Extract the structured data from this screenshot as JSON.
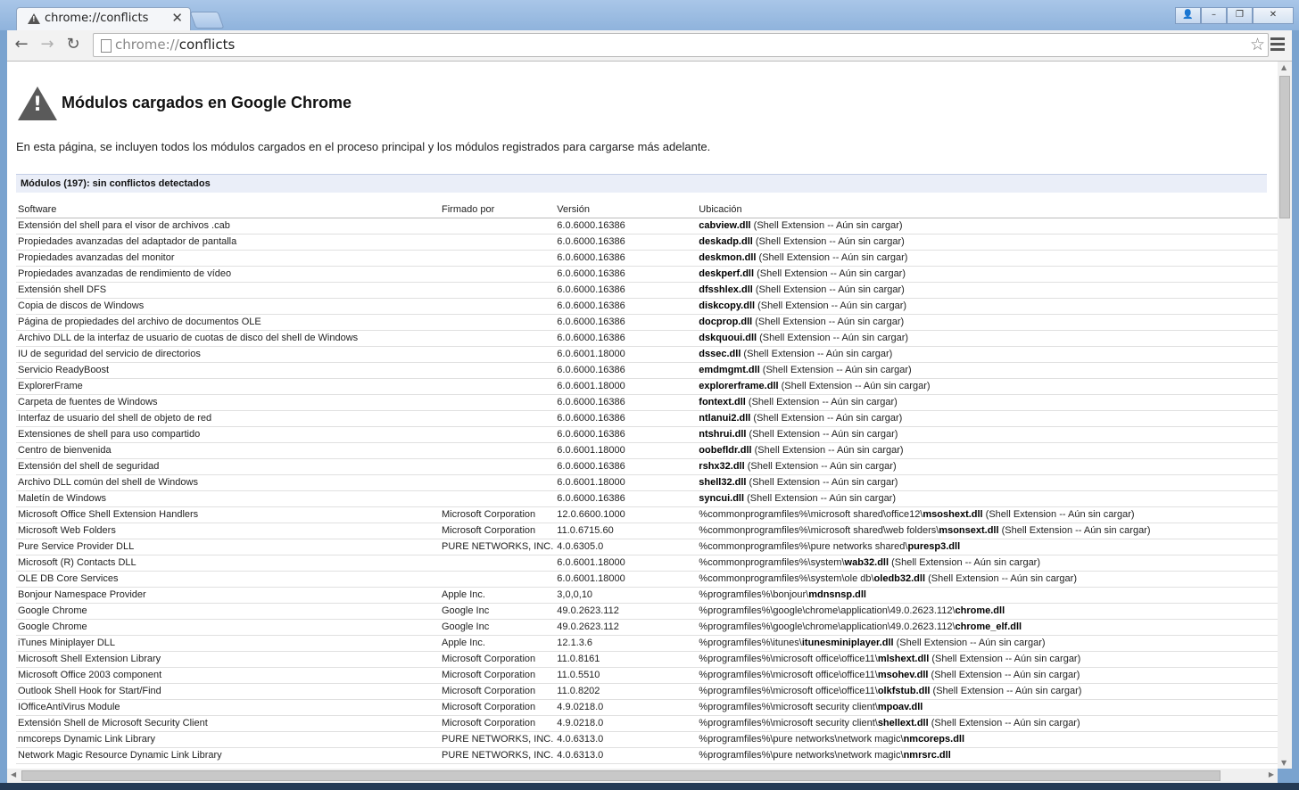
{
  "tab": {
    "title": "chrome://conflicts",
    "close": "✕"
  },
  "window_controls": {
    "profile": "👤",
    "minimize": "–",
    "restore": "❐",
    "close": "✕"
  },
  "toolbar": {
    "back": "←",
    "forward": "→",
    "reload": "↻",
    "url_scheme": "chrome://",
    "url_host": "conflicts",
    "star": "☆"
  },
  "page": {
    "title": "Módulos cargados en Google Chrome",
    "description": "En esta página, se incluyen todos los módulos cargados en el proceso principal y los módulos registrados para cargarse más adelante.",
    "summary": "Módulos (197): sin conflictos detectados"
  },
  "table": {
    "headers": [
      "Software",
      "Firmado por",
      "Versión",
      "Ubicación"
    ],
    "rows": [
      {
        "software": "Extensión del shell para el visor de archivos .cab",
        "signer": "",
        "version": "6.0.6000.16386",
        "path": "",
        "dll": "cabview.dll",
        "note": " (Shell Extension -- Aún sin cargar)"
      },
      {
        "software": "Propiedades avanzadas del adaptador de pantalla",
        "signer": "",
        "version": "6.0.6000.16386",
        "path": "",
        "dll": "deskadp.dll",
        "note": " (Shell Extension -- Aún sin cargar)"
      },
      {
        "software": "Propiedades avanzadas del monitor",
        "signer": "",
        "version": "6.0.6000.16386",
        "path": "",
        "dll": "deskmon.dll",
        "note": " (Shell Extension -- Aún sin cargar)"
      },
      {
        "software": "Propiedades avanzadas de rendimiento de vídeo",
        "signer": "",
        "version": "6.0.6000.16386",
        "path": "",
        "dll": "deskperf.dll",
        "note": " (Shell Extension -- Aún sin cargar)"
      },
      {
        "software": "Extensión shell DFS",
        "signer": "",
        "version": "6.0.6000.16386",
        "path": "",
        "dll": "dfsshlex.dll",
        "note": " (Shell Extension -- Aún sin cargar)"
      },
      {
        "software": "Copia de discos de Windows",
        "signer": "",
        "version": "6.0.6000.16386",
        "path": "",
        "dll": "diskcopy.dll",
        "note": " (Shell Extension -- Aún sin cargar)"
      },
      {
        "software": "Página de propiedades del archivo de documentos OLE",
        "signer": "",
        "version": "6.0.6000.16386",
        "path": "",
        "dll": "docprop.dll",
        "note": " (Shell Extension -- Aún sin cargar)"
      },
      {
        "software": "Archivo DLL de la interfaz de usuario de cuotas de disco del shell de Windows",
        "signer": "",
        "version": "6.0.6000.16386",
        "path": "",
        "dll": "dskquoui.dll",
        "note": " (Shell Extension -- Aún sin cargar)"
      },
      {
        "software": "IU de seguridad del servicio de directorios",
        "signer": "",
        "version": "6.0.6001.18000",
        "path": "",
        "dll": "dssec.dll",
        "note": " (Shell Extension -- Aún sin cargar)"
      },
      {
        "software": "Servicio ReadyBoost",
        "signer": "",
        "version": "6.0.6000.16386",
        "path": "",
        "dll": "emdmgmt.dll",
        "note": " (Shell Extension -- Aún sin cargar)"
      },
      {
        "software": "ExplorerFrame",
        "signer": "",
        "version": "6.0.6001.18000",
        "path": "",
        "dll": "explorerframe.dll",
        "note": " (Shell Extension -- Aún sin cargar)"
      },
      {
        "software": "Carpeta de fuentes de Windows",
        "signer": "",
        "version": "6.0.6000.16386",
        "path": "",
        "dll": "fontext.dll",
        "note": " (Shell Extension -- Aún sin cargar)"
      },
      {
        "software": "Interfaz de usuario del shell de objeto de red",
        "signer": "",
        "version": "6.0.6000.16386",
        "path": "",
        "dll": "ntlanui2.dll",
        "note": " (Shell Extension -- Aún sin cargar)"
      },
      {
        "software": "Extensiones de shell para uso compartido",
        "signer": "",
        "version": "6.0.6000.16386",
        "path": "",
        "dll": "ntshrui.dll",
        "note": " (Shell Extension -- Aún sin cargar)"
      },
      {
        "software": "Centro de bienvenida",
        "signer": "",
        "version": "6.0.6001.18000",
        "path": "",
        "dll": "oobefldr.dll",
        "note": " (Shell Extension -- Aún sin cargar)"
      },
      {
        "software": "Extensión del shell de seguridad",
        "signer": "",
        "version": "6.0.6000.16386",
        "path": "",
        "dll": "rshx32.dll",
        "note": " (Shell Extension -- Aún sin cargar)"
      },
      {
        "software": "Archivo DLL común del shell de Windows",
        "signer": "",
        "version": "6.0.6001.18000",
        "path": "",
        "dll": "shell32.dll",
        "note": " (Shell Extension -- Aún sin cargar)"
      },
      {
        "software": "Maletín de Windows",
        "signer": "",
        "version": "6.0.6000.16386",
        "path": "",
        "dll": "syncui.dll",
        "note": " (Shell Extension -- Aún sin cargar)"
      },
      {
        "software": "Microsoft Office Shell Extension Handlers",
        "signer": "Microsoft Corporation",
        "version": "12.0.6600.1000",
        "path": "%commonprogramfiles%\\microsoft shared\\office12\\",
        "dll": "msoshext.dll",
        "note": " (Shell Extension -- Aún sin cargar)"
      },
      {
        "software": "Microsoft Web Folders",
        "signer": "Microsoft Corporation",
        "version": "11.0.6715.60",
        "path": "%commonprogramfiles%\\microsoft shared\\web folders\\",
        "dll": "msonsext.dll",
        "note": " (Shell Extension -- Aún sin cargar)"
      },
      {
        "software": "Pure Service Provider DLL",
        "signer": "PURE NETWORKS, INC.",
        "version": "4.0.6305.0",
        "path": "%commonprogramfiles%\\pure networks shared\\",
        "dll": "puresp3.dll",
        "note": ""
      },
      {
        "software": "Microsoft (R) Contacts DLL",
        "signer": "",
        "version": "6.0.6001.18000",
        "path": "%commonprogramfiles%\\system\\",
        "dll": "wab32.dll",
        "note": " (Shell Extension -- Aún sin cargar)"
      },
      {
        "software": "OLE DB Core Services",
        "signer": "",
        "version": "6.0.6001.18000",
        "path": "%commonprogramfiles%\\system\\ole db\\",
        "dll": "oledb32.dll",
        "note": " (Shell Extension -- Aún sin cargar)"
      },
      {
        "software": "Bonjour Namespace Provider",
        "signer": "Apple Inc.",
        "version": "3,0,0,10",
        "path": "%programfiles%\\bonjour\\",
        "dll": "mdnsnsp.dll",
        "note": ""
      },
      {
        "software": "Google Chrome",
        "signer": "Google Inc",
        "version": "49.0.2623.112",
        "path": "%programfiles%\\google\\chrome\\application\\49.0.2623.112\\",
        "dll": "chrome.dll",
        "note": ""
      },
      {
        "software": "Google Chrome",
        "signer": "Google Inc",
        "version": "49.0.2623.112",
        "path": "%programfiles%\\google\\chrome\\application\\49.0.2623.112\\",
        "dll": "chrome_elf.dll",
        "note": ""
      },
      {
        "software": "iTunes Miniplayer DLL",
        "signer": "Apple Inc.",
        "version": "12.1.3.6",
        "path": "%programfiles%\\itunes\\",
        "dll": "itunesminiplayer.dll",
        "note": " (Shell Extension -- Aún sin cargar)"
      },
      {
        "software": "Microsoft Shell Extension Library",
        "signer": "Microsoft Corporation",
        "version": "11.0.8161",
        "path": "%programfiles%\\microsoft office\\office11\\",
        "dll": "mlshext.dll",
        "note": " (Shell Extension -- Aún sin cargar)"
      },
      {
        "software": "Microsoft Office 2003 component",
        "signer": "Microsoft Corporation",
        "version": "11.0.5510",
        "path": "%programfiles%\\microsoft office\\office11\\",
        "dll": "msohev.dll",
        "note": " (Shell Extension -- Aún sin cargar)"
      },
      {
        "software": "Outlook Shell Hook for Start/Find",
        "signer": "Microsoft Corporation",
        "version": "11.0.8202",
        "path": "%programfiles%\\microsoft office\\office11\\",
        "dll": "olkfstub.dll",
        "note": " (Shell Extension -- Aún sin cargar)"
      },
      {
        "software": "IOfficeAntiVirus Module",
        "signer": "Microsoft Corporation",
        "version": "4.9.0218.0",
        "path": "%programfiles%\\microsoft security client\\",
        "dll": "mpoav.dll",
        "note": ""
      },
      {
        "software": "Extensión Shell de Microsoft Security Client",
        "signer": "Microsoft Corporation",
        "version": "4.9.0218.0",
        "path": "%programfiles%\\microsoft security client\\",
        "dll": "shellext.dll",
        "note": " (Shell Extension -- Aún sin cargar)"
      },
      {
        "software": "nmcoreps Dynamic Link Library",
        "signer": "PURE NETWORKS, INC.",
        "version": "4.0.6313.0",
        "path": "%programfiles%\\pure networks\\network magic\\",
        "dll": "nmcoreps.dll",
        "note": ""
      },
      {
        "software": "Network Magic Resource Dynamic Link Library",
        "signer": "PURE NETWORKS, INC.",
        "version": "4.0.6313.0",
        "path": "%programfiles%\\pure networks\\network magic\\",
        "dll": "nmrsrc.dll",
        "note": ""
      }
    ]
  }
}
